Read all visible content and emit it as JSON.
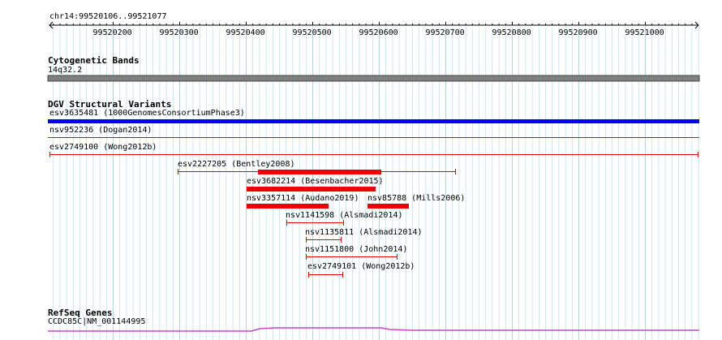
{
  "locus": "chr14:99520106..99521077",
  "ruler": {
    "ticks": [
      "99520200",
      "99520300",
      "99520400",
      "99520500",
      "99520600",
      "99520700",
      "99520800",
      "99520900",
      "99521000"
    ]
  },
  "tracks": {
    "cytoband": {
      "title": "Cytogenetic Bands",
      "band": "14q32.2"
    },
    "dgv": {
      "title": "DGV Structural Variants",
      "features": [
        {
          "label": "esv3635481 (1000GenomesConsortiumPhase3)",
          "color": "#0000ee"
        },
        {
          "label": "nsv952236 (Dogan2014)",
          "color": "#ee0000"
        },
        {
          "label": "esv2749100 (Wong2012b)",
          "color": "#ee0000"
        },
        {
          "label": "esv2227205 (Bentley2008)",
          "color": "#ee0000"
        },
        {
          "label": "esv3682214 (Besenbacher2015)",
          "color": "#ee0000"
        },
        {
          "label": "nsv3357114 (Audano2019)",
          "color": "#ee0000"
        },
        {
          "label": "nsv85788 (Mills2006)",
          "color": "#ee0000"
        },
        {
          "label": "nsv1141598 (Alsmadi2014)",
          "color": "#ee0000"
        },
        {
          "label": "nsv1135811 (Alsmadi2014)",
          "color": "#ee0000"
        },
        {
          "label": "nsv1151800 (John2014)",
          "color": "#ee0000"
        },
        {
          "label": "esv2749101 (Wong2012b)",
          "color": "#ee0000"
        }
      ]
    },
    "refseq": {
      "title": "RefSeq Genes",
      "gene": "CCDC85C|NM_001144995",
      "color": "#cc44cc"
    }
  },
  "colors": {
    "grid": "#add8e6",
    "ruler": "#000000",
    "cytoband": "#808080"
  }
}
